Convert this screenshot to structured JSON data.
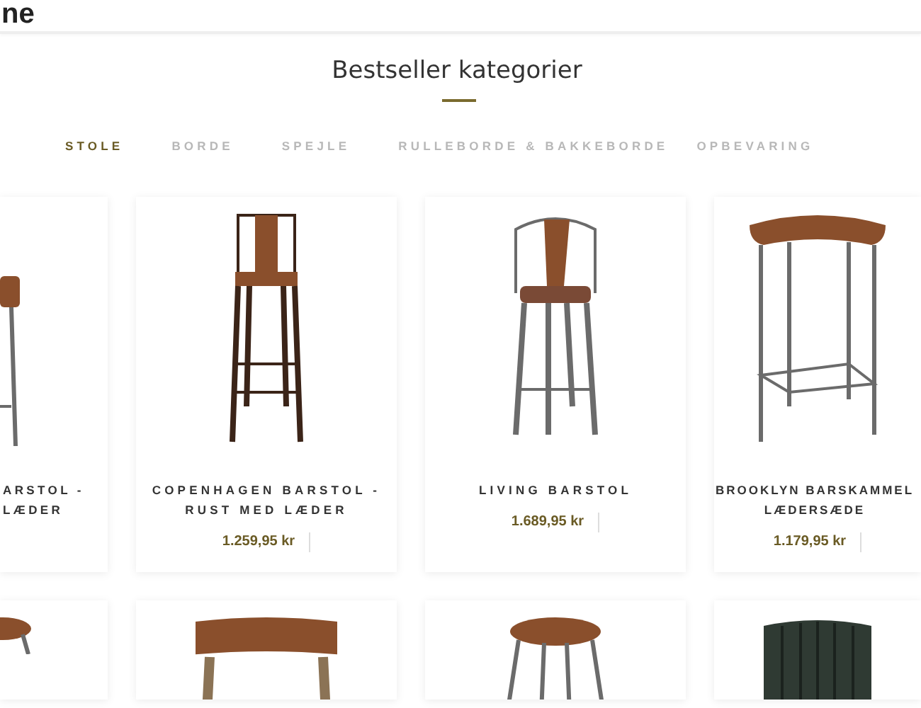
{
  "header": {
    "logo_text": "ne"
  },
  "section": {
    "title": "Bestseller kategorier"
  },
  "tabs": [
    {
      "label": "STOLE",
      "selected": true
    },
    {
      "label": "BORDE",
      "selected": false
    },
    {
      "label": "SPEJLE",
      "selected": false
    },
    {
      "label": "RULLEBORDE & BAKKEBORDE",
      "selected": false
    },
    {
      "label": "OPBEVARING",
      "selected": false
    }
  ],
  "products": [
    {
      "kind": "leather-stool",
      "name_lines": [
        "ARSTOL -",
        "LÆDER"
      ]
    },
    {
      "kind": "high-back",
      "name_lines": [
        "COPENHAGEN BARSTOL -",
        "RUST MED LÆDER"
      ],
      "price": "1.259,95 kr"
    },
    {
      "kind": "armchair-stool",
      "name_lines": [
        "LIVING BARSTOL"
      ],
      "price": "1.689,95 kr"
    },
    {
      "kind": "saddle-stool",
      "name_lines": [
        "BROOKLYN BARSKAMMEL",
        "LÆDERSÆDE"
      ],
      "price": "1.179,95 kr"
    }
  ],
  "more_products": [
    {
      "kind": "round-stool-cut"
    },
    {
      "kind": "strap-stool"
    },
    {
      "kind": "round-stool"
    },
    {
      "kind": "ribbed-chair"
    }
  ]
}
